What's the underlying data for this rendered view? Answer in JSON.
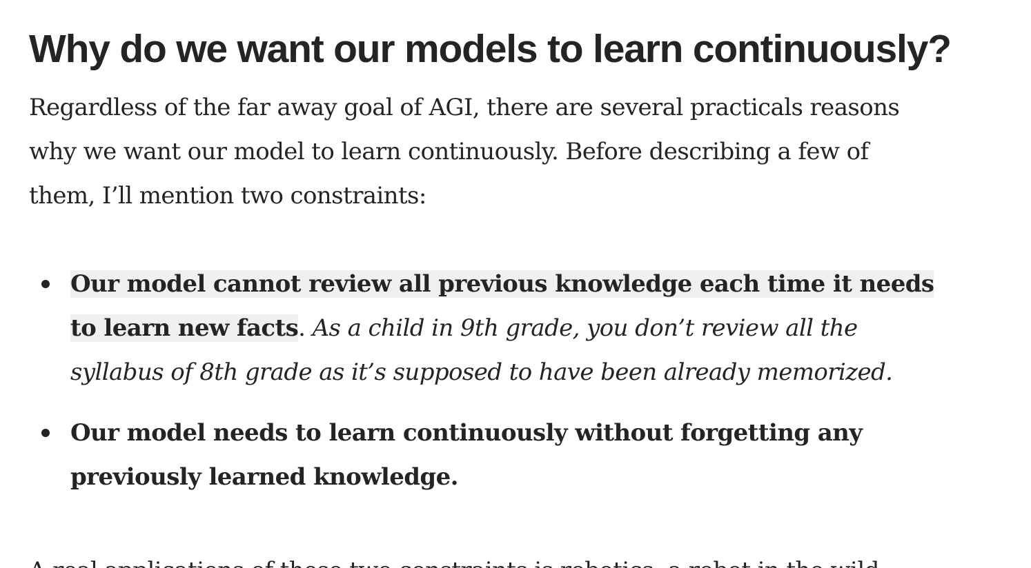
{
  "heading": "Why do we want our models to learn continuously?",
  "intro_lines": [
    "Regardless of the far away goal of AGI, there are several practicals reasons",
    "why we want our model to learn continuously. Before describing a few of",
    "them, I’ll mention two constraints:"
  ],
  "constraints": [
    {
      "line1_bold": "Our model cannot review all previous knowledge each time it needs",
      "line2_bold": "to learn new facts",
      "line2_punct": ".",
      "line2_italic": " As a child in 9th grade, you don’t review all the",
      "line3_italic": "syllabus of 8th grade as it’s supposed to have been already memorized."
    },
    {
      "line1_bold": "Our model needs to learn continuously without forgetting any",
      "line2_bold": "previously learned knowledge."
    }
  ],
  "next_paragraph_partial": "A real applications of these two constraints is robotics: a robot in the wild"
}
